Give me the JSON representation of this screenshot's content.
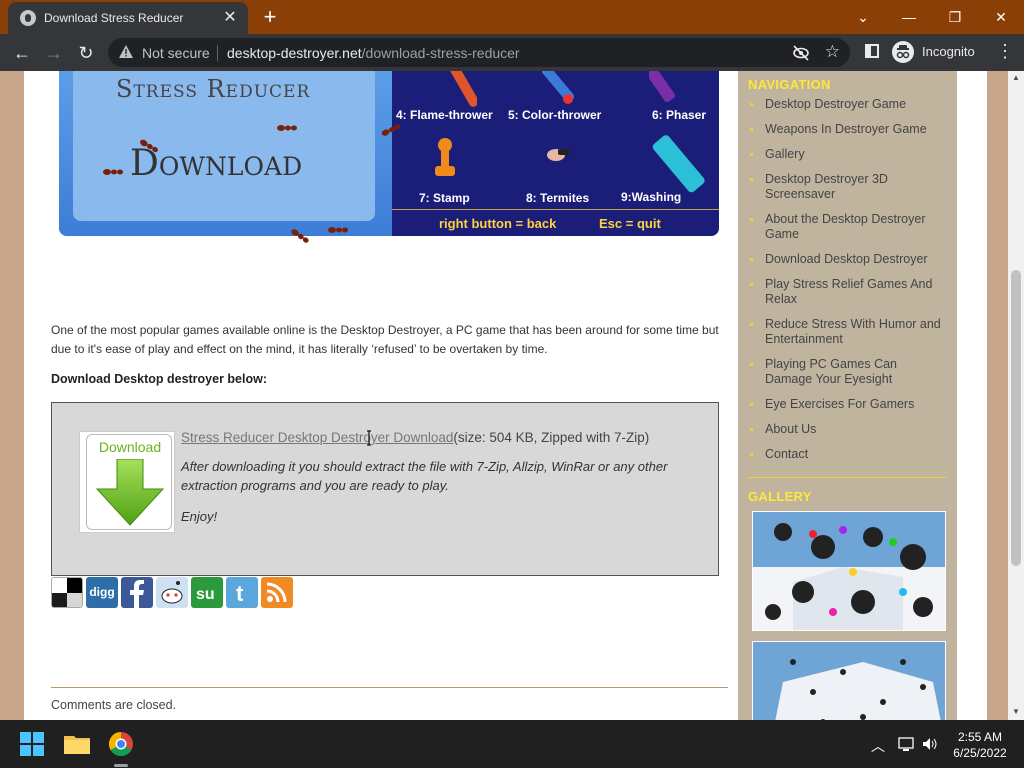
{
  "browser": {
    "tab_title": "Download Stress Reducer",
    "tab_close": "✕",
    "new_tab": "+",
    "window_controls": [
      "⌄",
      "—",
      "❐",
      "✕"
    ],
    "nav": {
      "back": "←",
      "forward": "→",
      "reload": "↻"
    },
    "not_secure": "Not secure",
    "url_host": "desktop-destroyer.net",
    "url_path": "/download-stress-reducer",
    "star": "☆",
    "incognito": "Incognito",
    "menu": "⋮"
  },
  "banner": {
    "title": "Stress Reducer",
    "download": "Download",
    "weapons": [
      "4: Flame-thrower",
      "5: Color-thrower",
      "6: Phaser",
      "7: Stamp",
      "8: Termites",
      "9:Washing"
    ],
    "hint_left": "right button = back",
    "hint_right": "Esc = quit"
  },
  "main": {
    "intro": "One of the most popular games available online is the Desktop Destroyer, a PC game that has been around for some time but due to it's ease of play and effect on the mind, it has literally ‘refused’ to be overtaken by time.",
    "download_heading": "Download Desktop destroyer below:",
    "download_icon_label": "Download",
    "download_link": "Stress Reducer Desktop Destroyer Download",
    "download_meta": "(size: 504 KB,  Zipped with 7-Zip)",
    "download_desc": "After downloading it you should extract the file with 7-Zip, Allzip, WinRar or any other extraction programs and you are ready to play.",
    "download_enjoy": "Enjoy!",
    "social_buttons": [
      "delicious",
      "digg",
      "facebook",
      "reddit",
      "stumbleupon",
      "twitter",
      "rss"
    ],
    "social_digg_text": "digg",
    "comments_closed": "Comments are closed."
  },
  "sidebar": {
    "nav_heading": "NAVIGATION",
    "nav_items": [
      "Desktop Destroyer Game",
      "Weapons In Destroyer Game",
      "Gallery",
      "Desktop Destroyer 3D Screensaver",
      "About the Desktop Destroyer Game",
      "Download Desktop Destroyer",
      "Play Stress Relief Games And Relax",
      "Reduce Stress With Humor and Entertainment",
      "Playing PC Games Can Damage Your Eyesight",
      "Eye Exercises For Gamers",
      "About Us",
      "Contact"
    ],
    "gallery_heading": "GALLERY"
  },
  "taskbar": {
    "time": "2:55 AM",
    "date": "6/25/2022"
  },
  "colors": {
    "titlebar": "#8a3f06",
    "toolbar": "#35363a",
    "page_bg": "#c9a689",
    "sidebar_bg": "#c0b49f",
    "sidebar_heading": "#ffe83a",
    "banner_dark": "#1b1e79",
    "banner_light": "#8ab9ee",
    "download_green": "#6bb31f"
  }
}
